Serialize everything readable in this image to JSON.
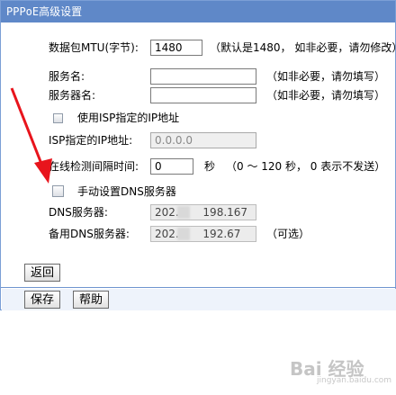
{
  "title": "PPPoE高级设置",
  "mtu": {
    "label": "数据包MTU(字节):",
    "value": "1480",
    "hint": "（默认是1480， 如非必要，请勿修改）"
  },
  "service_name": {
    "label": "服务名:",
    "value": "",
    "hint": "（如非必要，请勿填写）"
  },
  "server_name": {
    "label": "服务器名:",
    "value": "",
    "hint": "（如非必要，请勿填写）"
  },
  "isp_ip_checkbox": {
    "label": "使用ISP指定的IP地址",
    "checked": false
  },
  "isp_ip": {
    "label": "ISP指定的IP地址:",
    "value": "0.0.0.0"
  },
  "idle_interval": {
    "label": "在线检测间隔时间:",
    "value": "0",
    "unit": "秒",
    "hint": "（0 ～ 120 秒， 0 表示不发送）"
  },
  "manual_dns_checkbox": {
    "label": "手动设置DNS服务器",
    "checked": false
  },
  "dns": {
    "label": "DNS服务器:",
    "value": "202.9     198.167"
  },
  "alt_dns": {
    "label": "备用DNS服务器:",
    "value": "202.9     192.67",
    "hint": "（可选）"
  },
  "buttons": {
    "back": "返回",
    "save": "保存",
    "help": "帮助"
  },
  "watermark": {
    "text": "Bai 经验",
    "sub": "jingyan.baidu.com"
  },
  "colors": {
    "titlebar": "#5f88c8",
    "arrow": "#e8141c",
    "border": "#7b9fd6"
  }
}
